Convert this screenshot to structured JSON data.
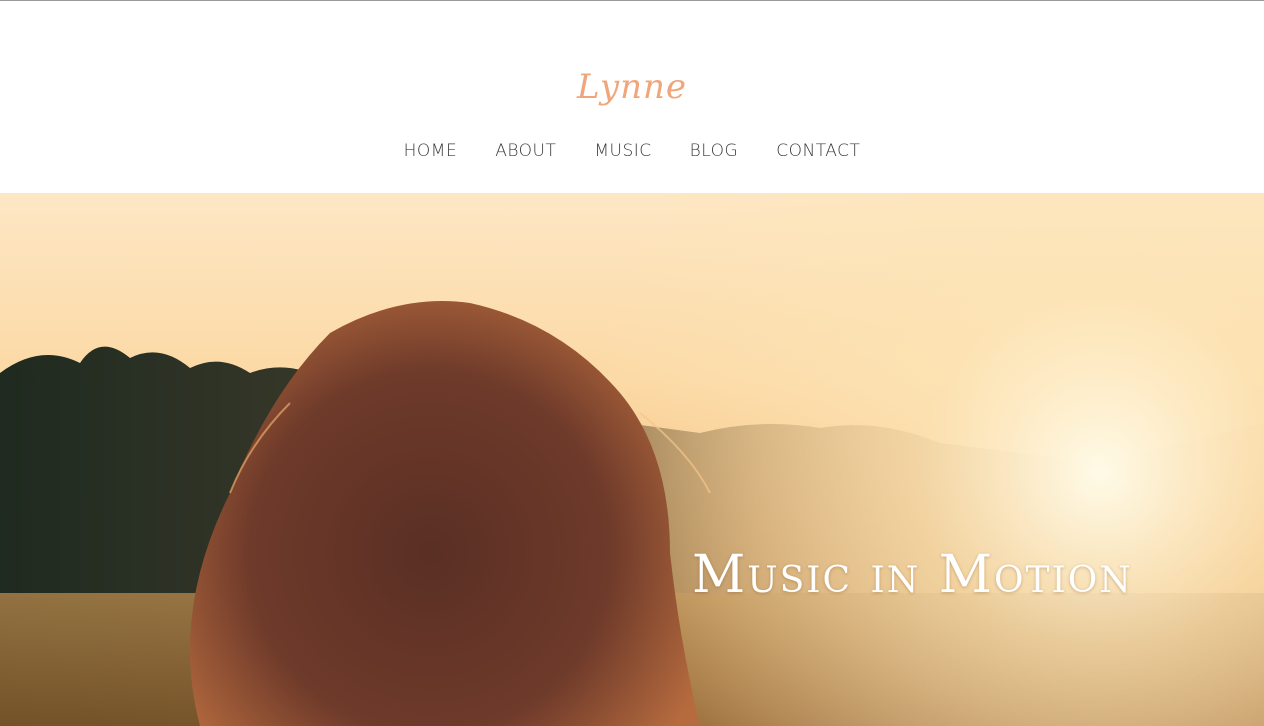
{
  "site": {
    "logo_text": "Lynne",
    "logo_color": "#f0a57a"
  },
  "nav": {
    "items": [
      {
        "label": "HOME"
      },
      {
        "label": "ABOUT"
      },
      {
        "label": "MUSIC"
      },
      {
        "label": "BLOG"
      },
      {
        "label": "CONTACT"
      }
    ]
  },
  "hero": {
    "title": "Music in Motion",
    "image_description_icon": "sunset-portrait-photo"
  }
}
